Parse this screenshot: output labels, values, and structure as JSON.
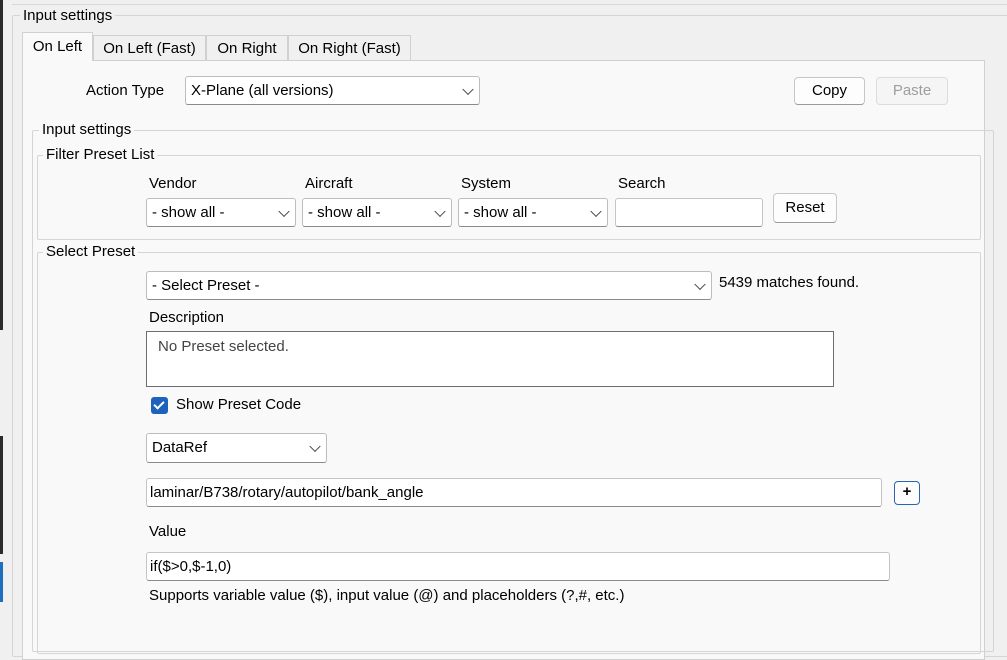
{
  "outer_group": {
    "legend": "Input settings"
  },
  "tabs": [
    {
      "label": "On Left",
      "active": true
    },
    {
      "label": "On Left (Fast)",
      "active": false
    },
    {
      "label": "On Right",
      "active": false
    },
    {
      "label": "On Right (Fast)",
      "active": false
    }
  ],
  "action_type": {
    "label": "Action Type",
    "value": "X-Plane (all versions)"
  },
  "buttons": {
    "copy": "Copy",
    "paste": "Paste",
    "reset": "Reset",
    "add": "+"
  },
  "input_settings": {
    "legend": "Input settings"
  },
  "filter": {
    "legend": "Filter Preset List",
    "vendor": {
      "label": "Vendor",
      "value": "- show all -"
    },
    "aircraft": {
      "label": "Aircraft",
      "value": "- show all -"
    },
    "system": {
      "label": "System",
      "value": "- show all -"
    },
    "search": {
      "label": "Search",
      "value": ""
    }
  },
  "select_preset": {
    "legend": "Select Preset",
    "dropdown_value": "- Select Preset -",
    "matches": "5439 matches found.",
    "description_label": "Description",
    "description_text": "No Preset selected.",
    "show_code_label": "Show Preset Code",
    "show_code_checked": true,
    "code_type": "DataRef",
    "dataref_value": "laminar/B738/rotary/autopilot/bank_angle",
    "value_label": "Value",
    "value_text": "if($>0,$-1,0)",
    "hint": "Supports variable value ($), input value (@) and placeholders (?,#, etc.)"
  },
  "colors": {
    "accent": "#1d63bd",
    "background": "#f0f0f0",
    "panel": "#f9f9f9"
  }
}
